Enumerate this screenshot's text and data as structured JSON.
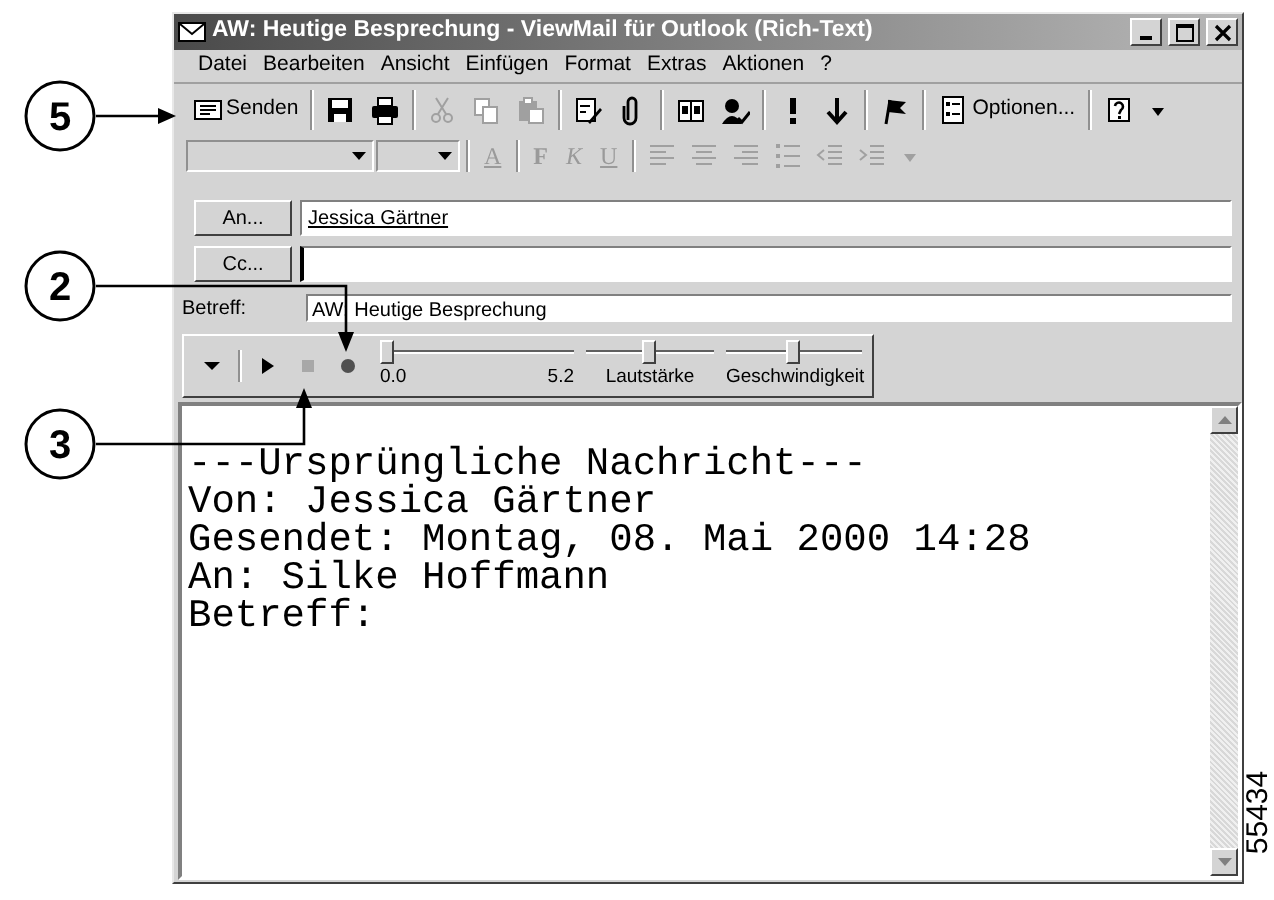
{
  "window": {
    "title": "AW: Heutige Besprechung - ViewMail für Outlook (Rich-Text)"
  },
  "menu": [
    "Datei",
    "Bearbeiten",
    "Ansicht",
    "Einfügen",
    "Format",
    "Extras",
    "Aktionen",
    "?"
  ],
  "toolbar": [
    {
      "kind": "text",
      "label": "Senden",
      "disabled": false
    },
    {
      "kind": "separator"
    },
    {
      "kind": "icon",
      "disabled": false
    },
    {
      "kind": "icon",
      "disabled": false
    },
    {
      "kind": "separator"
    },
    {
      "kind": "icon",
      "disabled": true
    },
    {
      "kind": "icon",
      "disabled": true
    },
    {
      "kind": "icon",
      "disabled": true
    },
    {
      "kind": "separator"
    },
    {
      "kind": "icon",
      "disabled": false
    },
    {
      "kind": "icon",
      "disabled": false
    },
    {
      "kind": "separator"
    },
    {
      "kind": "icon",
      "disabled": false
    },
    {
      "kind": "icon",
      "disabled": false
    },
    {
      "kind": "separator"
    },
    {
      "kind": "icon",
      "disabled": false
    },
    {
      "kind": "icon",
      "disabled": false
    },
    {
      "kind": "separator"
    },
    {
      "kind": "icon",
      "disabled": false
    },
    {
      "kind": "separator"
    },
    {
      "kind": "text",
      "label": "Optionen...",
      "disabled": false
    },
    {
      "kind": "separator"
    },
    {
      "kind": "icon",
      "disabled": false
    },
    {
      "kind": "icon",
      "disabled": false
    }
  ],
  "format_toolbar": [
    {
      "kind": "combo",
      "disabled": true
    },
    {
      "kind": "combo",
      "disabled": true
    },
    {
      "kind": "separator"
    },
    {
      "kind": "letter",
      "label": "A",
      "disabled": true
    },
    {
      "kind": "separator"
    },
    {
      "kind": "letter",
      "label": "F",
      "disabled": true
    },
    {
      "kind": "letter",
      "label": "K",
      "disabled": true
    },
    {
      "kind": "letter",
      "label": "U",
      "disabled": true
    },
    {
      "kind": "separator"
    },
    {
      "kind": "icon",
      "disabled": true
    },
    {
      "kind": "icon",
      "disabled": true
    },
    {
      "kind": "icon",
      "disabled": true
    },
    {
      "kind": "icon",
      "disabled": true
    },
    {
      "kind": "icon",
      "disabled": true
    },
    {
      "kind": "icon",
      "disabled": true
    },
    {
      "kind": "icon",
      "disabled": true
    }
  ],
  "header": {
    "to": {
      "button": "An...",
      "value": "Jessica Gärtner"
    },
    "cc": {
      "button": "Cc..."
    },
    "subject": {
      "label": "Betreff:",
      "value": "AW: Heutige Besprechung"
    }
  },
  "player": {
    "buttons": [
      {
        "kind": "menu",
        "disabled": false
      },
      {
        "kind": "separator"
      },
      {
        "kind": "play",
        "disabled": false
      },
      {
        "kind": "stop",
        "disabled": true
      },
      {
        "kind": "record",
        "disabled": false
      }
    ],
    "sliders": [
      {
        "kind": "position",
        "level": 0,
        "start": "0.0",
        "end": "5.2"
      },
      {
        "kind": "volume",
        "level": 0.5,
        "label": "Lautstärke"
      },
      {
        "kind": "speed",
        "level": 0.5,
        "label": "Geschwindigkeit"
      }
    ]
  },
  "body": [
    "---Ursprüngliche Nachricht---",
    "Von: Jessica Gärtner",
    "Gesendet: Montag, 08. Mai 2000 14:28",
    "An: Silke Hoffmann",
    "Betreff:"
  ],
  "callouts": [
    {
      "label": "5"
    },
    {
      "label": "2"
    },
    {
      "label": "3"
    }
  ],
  "figure_number": "55434"
}
